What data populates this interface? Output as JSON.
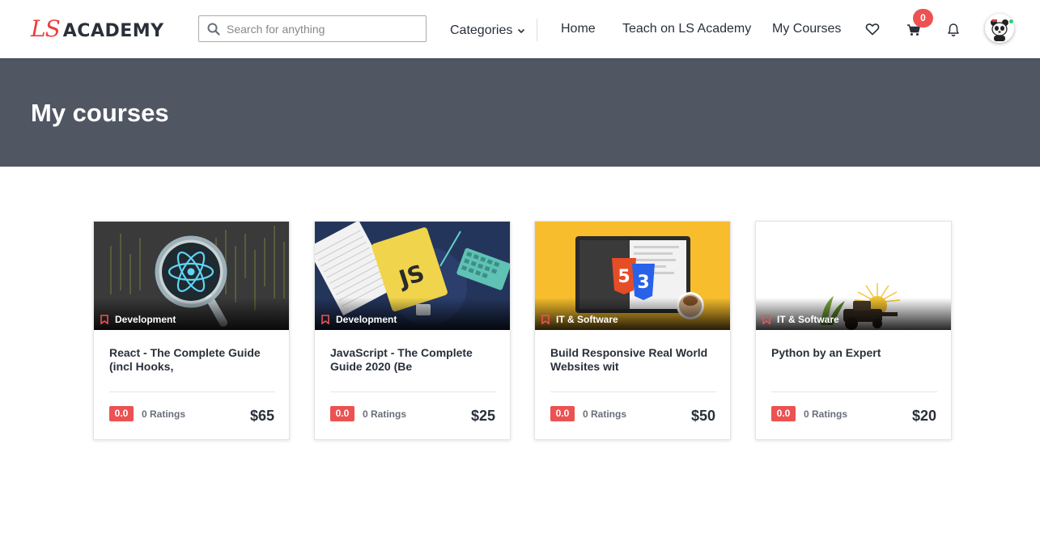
{
  "header": {
    "logo_ls": "LS",
    "logo_academy": "ACADEMY",
    "search_placeholder": "Search for anything",
    "categories_label": "Categories",
    "nav": {
      "home": "Home",
      "teach": "Teach on LS Academy",
      "my_courses": "My Courses"
    },
    "cart_count": "0",
    "icons": [
      "search-icon",
      "chevron-down-icon",
      "heart-icon",
      "cart-icon",
      "bell-icon",
      "avatar"
    ]
  },
  "banner": {
    "title": "My courses"
  },
  "colors": {
    "brand_red": "#e8403e",
    "badge_red": "#ec5252",
    "banner_bg": "#505763",
    "text_dark": "#29303b"
  },
  "courses": [
    {
      "category": "Development",
      "title": "React - The Complete Guide (incl Hooks,",
      "rating": "0.0",
      "ratings_label": "0 Ratings",
      "price": "$65",
      "image": "react-thumbnail"
    },
    {
      "category": "Development",
      "title": "JavaScript - The Complete Guide 2020 (Be",
      "rating": "0.0",
      "ratings_label": "0 Ratings",
      "price": "$25",
      "image": "javascript-thumbnail"
    },
    {
      "category": "IT & Software",
      "title": "Build Responsive Real World Websites wit",
      "rating": "0.0",
      "ratings_label": "0 Ratings",
      "price": "$50",
      "image": "html-css-thumbnail"
    },
    {
      "category": "IT & Software",
      "title": "Python by an Expert",
      "rating": "0.0",
      "ratings_label": "0 Ratings",
      "price": "$20",
      "image": "python-thumbnail"
    }
  ]
}
